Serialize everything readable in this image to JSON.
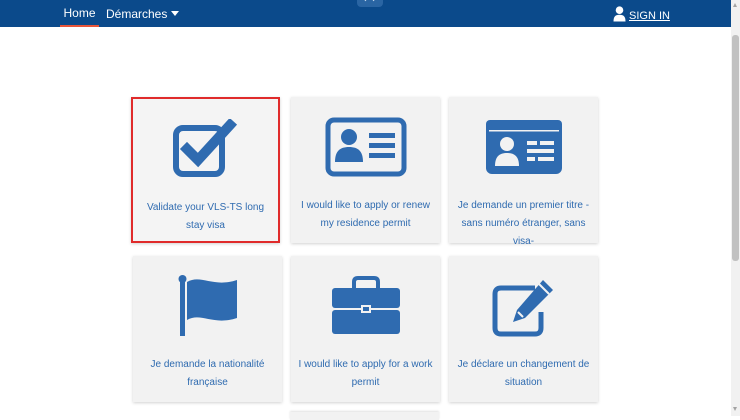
{
  "navbar": {
    "home_label": "Home",
    "demarches_label": "Démarches",
    "signin_label": "SIGN IN",
    "bg_color": "#0b4a8b"
  },
  "cards": [
    {
      "label": "Validate your VLS-TS long stay visa",
      "icon": "checkbox-checked-icon",
      "selected": true
    },
    {
      "label": "I would like to apply or renew my residence permit",
      "icon": "id-card-icon",
      "selected": false
    },
    {
      "label": "Je demande un premier titre -sans numéro étranger, sans visa-",
      "icon": "id-card-filled-icon",
      "selected": false
    },
    {
      "label": "Je demande la nationalité française",
      "icon": "flag-icon",
      "selected": false
    },
    {
      "label": "I would like to apply for a work permit",
      "icon": "briefcase-icon",
      "selected": false
    },
    {
      "label": "Je déclare un changement de situation",
      "icon": "edit-icon",
      "selected": false
    }
  ],
  "colors": {
    "icon_blue": "#2f6bb0",
    "selected_border": "#e02b2b"
  }
}
